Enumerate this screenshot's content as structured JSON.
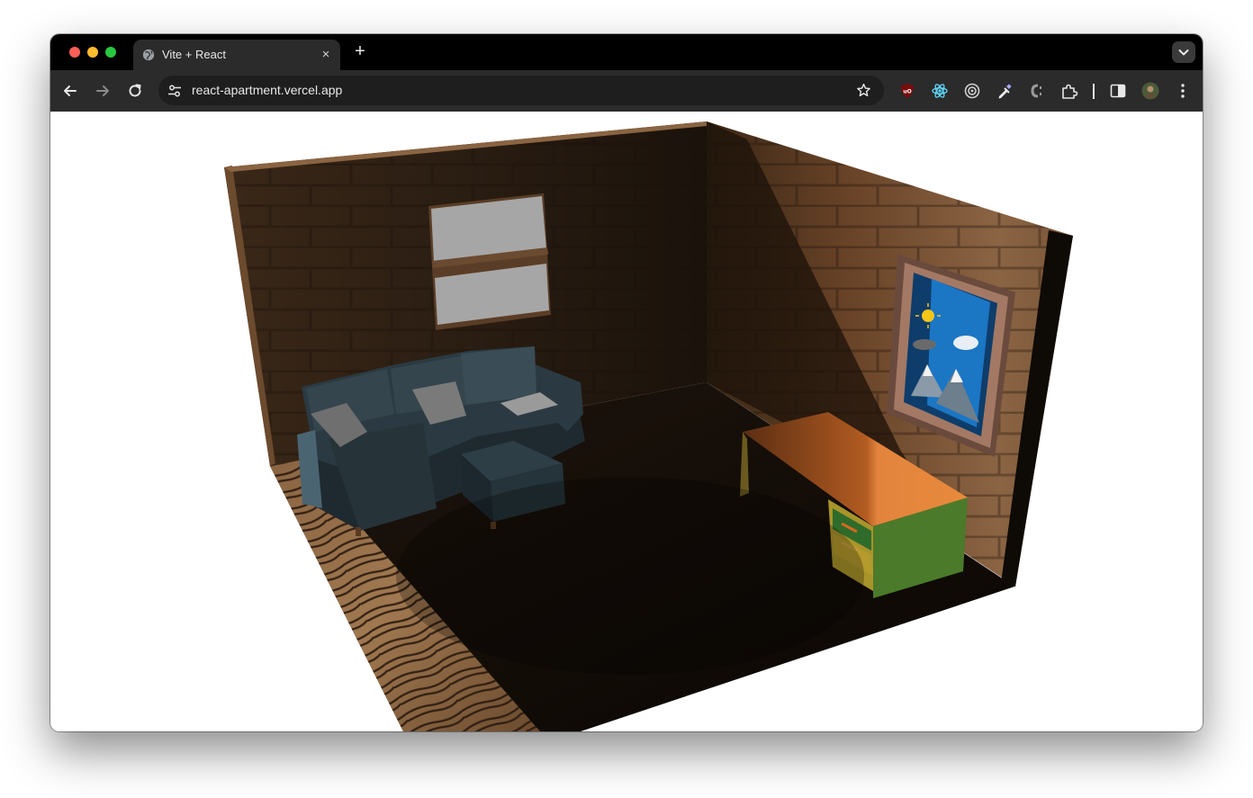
{
  "browser": {
    "tab": {
      "title": "Vite + React",
      "close_label": "×",
      "favicon": "globe-icon"
    },
    "new_tab_label": "+",
    "omnibox": {
      "url": "react-apartment.vercel.app"
    },
    "extensions": [
      "ublock-origin-icon",
      "react-devtools-icon",
      "target-icon",
      "eyedropper-icon",
      "css-icon",
      "puzzle-icon"
    ],
    "colors": {
      "tabbar": "#000000",
      "toolbar": "#2b2b2b",
      "omnibox": "#1e1e1e"
    }
  },
  "scene": {
    "description_icon": "3d-room-canvas",
    "objects": [
      "back-wall",
      "right-wall",
      "floor",
      "window",
      "sofa",
      "ottoman",
      "desk",
      "framed-picture"
    ]
  }
}
